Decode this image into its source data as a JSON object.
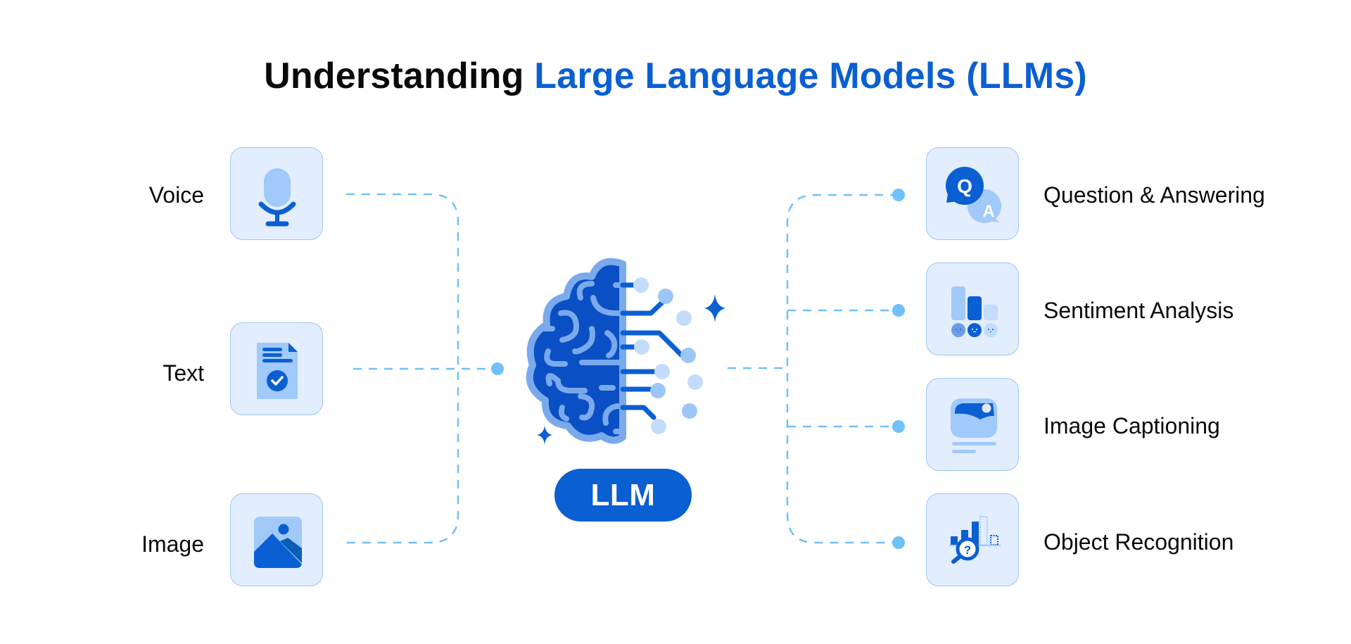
{
  "title": {
    "prefix": "Understanding ",
    "highlight": "Large Language Models (LLMs)"
  },
  "colors": {
    "accent": "#0a5fd2",
    "box_bg": "#e2edfd",
    "box_border": "#9cc6f5",
    "connector": "#6ec1fb",
    "light_blue": "#a1c9fa"
  },
  "inputs": [
    {
      "label": "Voice",
      "icon": "microphone-icon"
    },
    {
      "label": "Text",
      "icon": "document-check-icon"
    },
    {
      "label": "Image",
      "icon": "picture-icon"
    }
  ],
  "center": {
    "icon": "brain-circuit-icon",
    "badge": "LLM"
  },
  "outputs": [
    {
      "label": "Question & Answering",
      "icon": "qa-chat-icon",
      "q": "Q",
      "a": "A"
    },
    {
      "label": "Sentiment Analysis",
      "icon": "sentiment-bars-icon"
    },
    {
      "label": "Image Captioning",
      "icon": "image-caption-icon"
    },
    {
      "label": "Object Recognition",
      "icon": "magnifier-chart-icon",
      "mark": "?"
    }
  ]
}
